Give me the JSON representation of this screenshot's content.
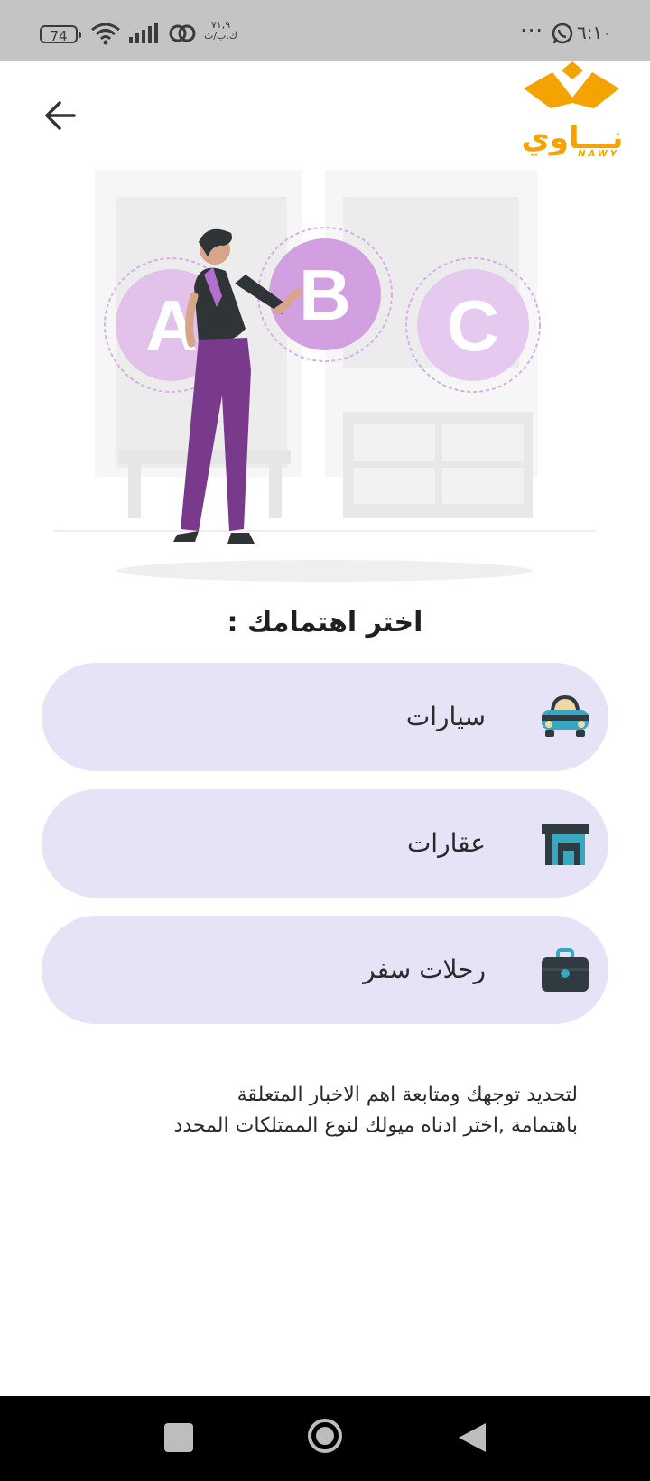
{
  "status_bar": {
    "time": "٦:١٠",
    "dots": "···",
    "battery": "74",
    "speed_value": "٧١,٩",
    "speed_unit": "ك.ب/ث"
  },
  "header": {
    "back_icon": "arrow-left-icon",
    "logo_text": "نـــاوي",
    "logo_sub": "NAWY"
  },
  "illustration": {
    "letters": [
      "A",
      "B",
      "C"
    ]
  },
  "title": "اختر اهتمامك :",
  "options": [
    {
      "label": "سيارات",
      "icon": "car-icon"
    },
    {
      "label": "عقارات",
      "icon": "building-icon"
    },
    {
      "label": "رحلات سفر",
      "icon": "suitcase-icon"
    }
  ],
  "description": {
    "line1": "لتحديد توجهك ومتابعة اهم الاخبار المتعلقة",
    "line2": "باهتمامة ,اختر ادناه ميولك لنوع الممتلكات المحدد"
  },
  "colors": {
    "accent": "#f5a300",
    "option_bg": "#e7e3f6",
    "icon_dark": "#2f3b40",
    "icon_teal": "#3aa7c0",
    "purple": "#b98bd8"
  }
}
